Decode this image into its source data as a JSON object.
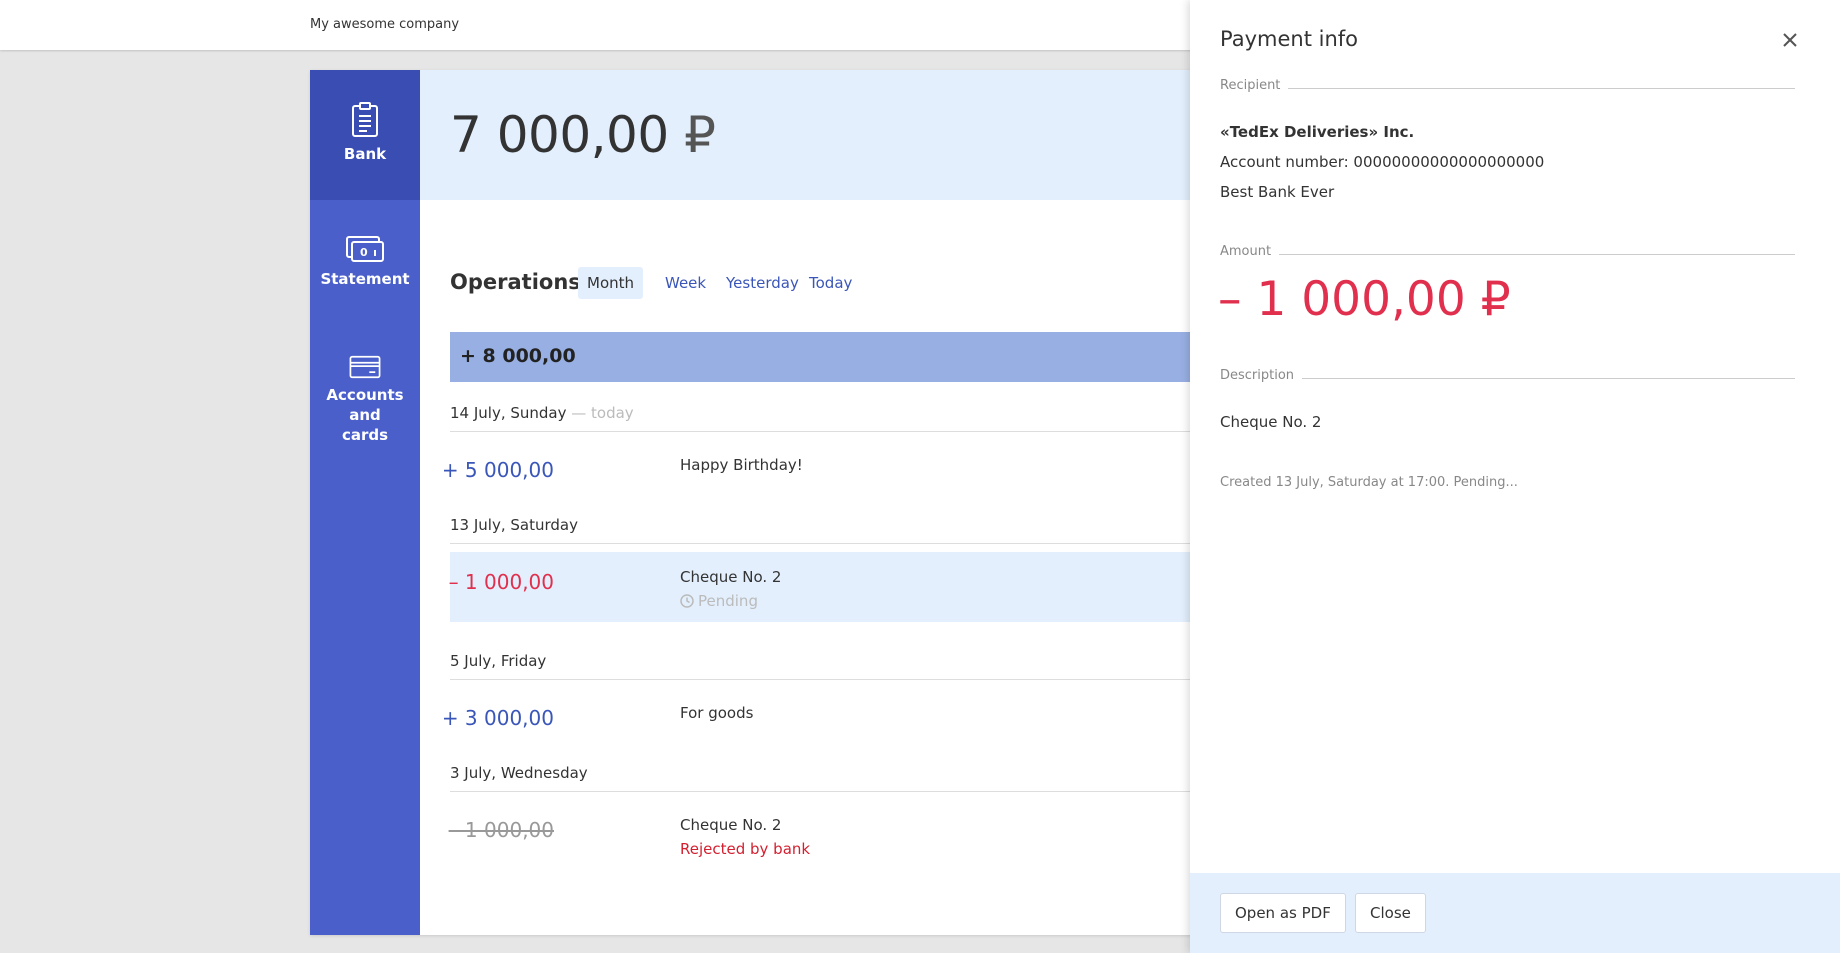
{
  "header": {
    "company": "My awesome company"
  },
  "sidebar": {
    "items": [
      {
        "label": "Bank",
        "icon": "clipboard-icon",
        "active": true
      },
      {
        "label": "Statement",
        "icon": "banknotes-icon"
      },
      {
        "label": "Accounts and cards",
        "icon": "card-icon"
      }
    ]
  },
  "balance": {
    "amount": "7 000,00",
    "currency": "₽"
  },
  "operations": {
    "title": "Operations",
    "filters": [
      "Month",
      "Week",
      "Yesterday",
      "Today"
    ],
    "selected_filter": "Month",
    "total": "+ 8 000,00",
    "groups": [
      {
        "date": "14 July, Sunday",
        "note": " — today",
        "items": [
          {
            "amount": "+ 5 000,00",
            "description": "Happy Birthday!"
          }
        ]
      },
      {
        "date": "13 July, Saturday",
        "items": [
          {
            "amount": "– 1 000,00",
            "description": "Cheque No. 2",
            "status": "Pending"
          }
        ]
      },
      {
        "date": "5 July, Friday",
        "items": [
          {
            "amount": "+ 3 000,00",
            "description": "For goods"
          }
        ]
      },
      {
        "date": "3 July, Wednesday",
        "items": [
          {
            "amount": "– 1 000,00",
            "description": "Cheque No. 2",
            "status": "Rejected by bank"
          }
        ]
      }
    ]
  },
  "payment_info": {
    "title": "Payment info",
    "recipient_label": "Recipient",
    "recipient_name": "«TedEx Deliveries» Inc.",
    "account_number": "Account number: 00000000000000000000",
    "bank": "Best Bank Ever",
    "amount_label": "Amount",
    "amount": "– 1 000,00",
    "currency": "₽",
    "description_label": "Description",
    "description": "Cheque No. 2",
    "created": "Created 13 July, Saturday at 17:00. Pending...",
    "open_pdf_label": "Open as PDF",
    "close_label": "Close"
  },
  "colors": {
    "sidebar": "#4a5fc9",
    "sidebar_active": "#3a4db3",
    "accent_blue": "#3a56b8",
    "negative": "#e0304e",
    "rejected": "#d41f2f",
    "light_blue": "#e3effd",
    "total_bar": "#98afe3"
  }
}
